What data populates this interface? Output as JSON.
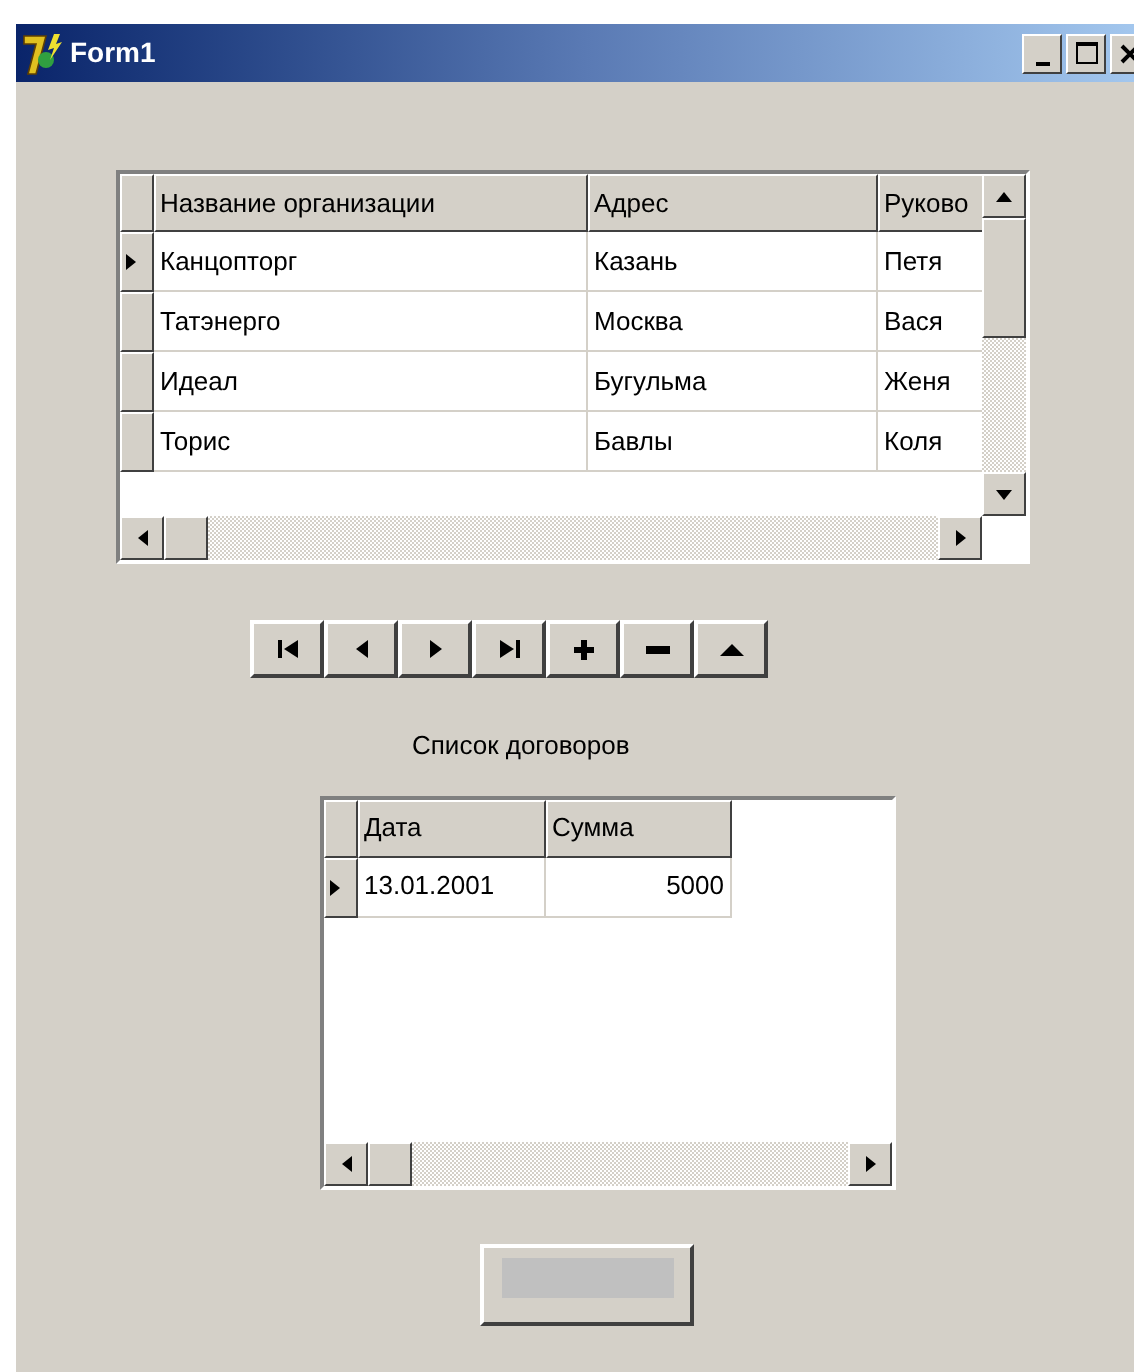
{
  "window": {
    "title": "Form1"
  },
  "organizations_grid": {
    "columns": [
      {
        "label": "Название организации"
      },
      {
        "label": "Адрес"
      },
      {
        "label": "Руково"
      }
    ],
    "rows": [
      {
        "cells": [
          "Канцопторг",
          "Казань",
          "Петя"
        ],
        "selected": true
      },
      {
        "cells": [
          "Татэнерго",
          "Москва",
          "Вася"
        ],
        "selected": false
      },
      {
        "cells": [
          "Идеал",
          "Бугульма",
          "Женя"
        ],
        "selected": false
      },
      {
        "cells": [
          "Торис",
          "Бавлы",
          "Коля"
        ],
        "selected": false
      }
    ]
  },
  "navigator": {
    "buttons": [
      {
        "kind": "first"
      },
      {
        "kind": "prior"
      },
      {
        "kind": "next"
      },
      {
        "kind": "last"
      },
      {
        "kind": "insert"
      },
      {
        "kind": "delete"
      },
      {
        "kind": "edit"
      }
    ]
  },
  "contracts_label": "Список договоров",
  "contracts_grid": {
    "columns": [
      {
        "label": "Дата",
        "kind": "text"
      },
      {
        "label": "Сумма",
        "kind": "number"
      }
    ],
    "rows": [
      {
        "cells": [
          "13.01.2001",
          "5000"
        ],
        "selected": true
      }
    ]
  }
}
